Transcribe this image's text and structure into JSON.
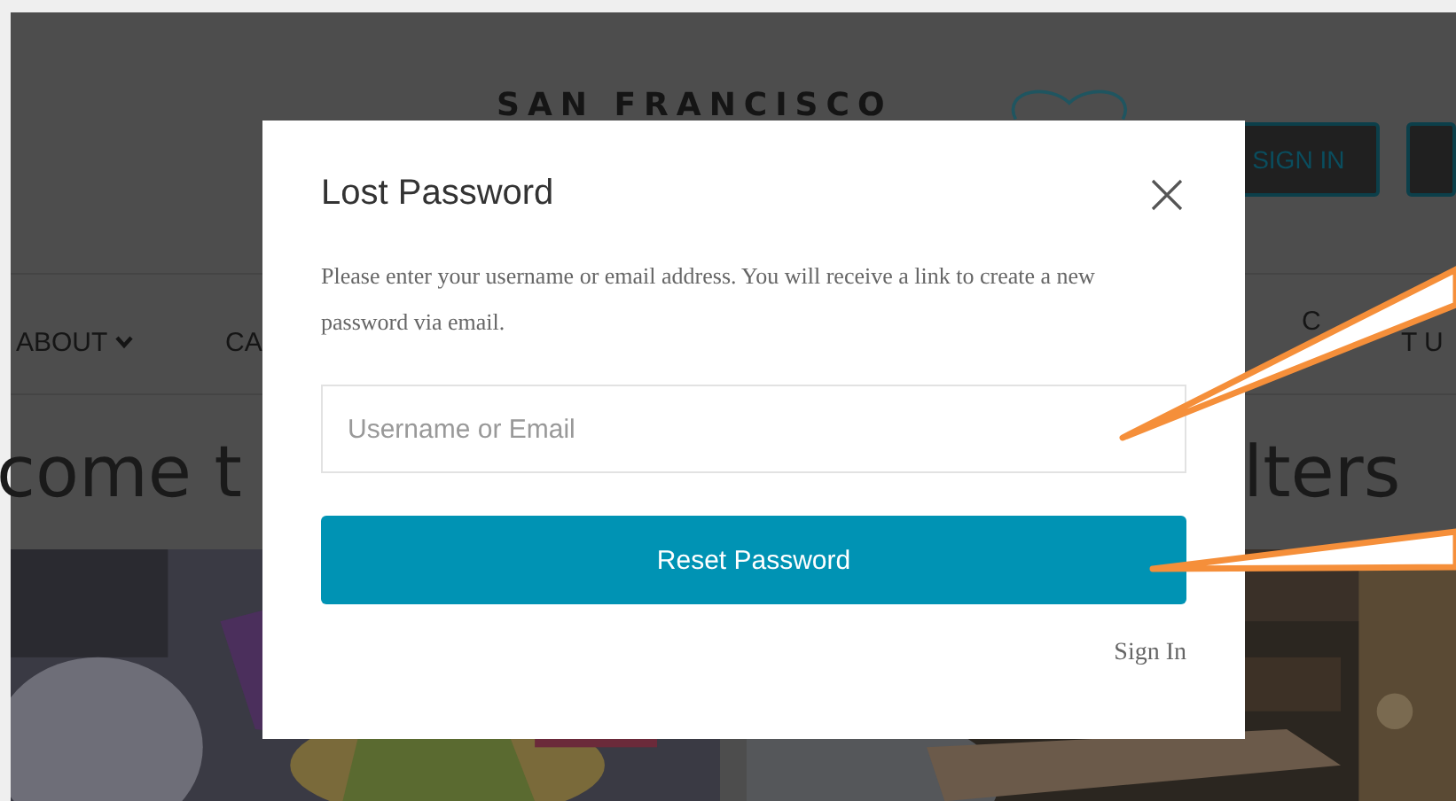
{
  "header": {
    "title": "SAN FRANCISCO",
    "sign_in_button": "SIGN IN"
  },
  "nav": [
    {
      "label": "ABOUT",
      "has_dropdown": true
    },
    {
      "label": "CA",
      "has_dropdown": false
    },
    {
      "label": "C",
      "has_dropdown": false
    },
    {
      "label": "T U",
      "has_dropdown": false
    }
  ],
  "hero": {
    "left_fragment": "come t",
    "right_fragment": "lters"
  },
  "modal": {
    "title": "Lost Password",
    "description": "Please enter your username or email address. You will receive a link to create a new password via email.",
    "field": {
      "placeholder": "Username or Email"
    },
    "button": "Reset Password",
    "link": "Sign In"
  }
}
